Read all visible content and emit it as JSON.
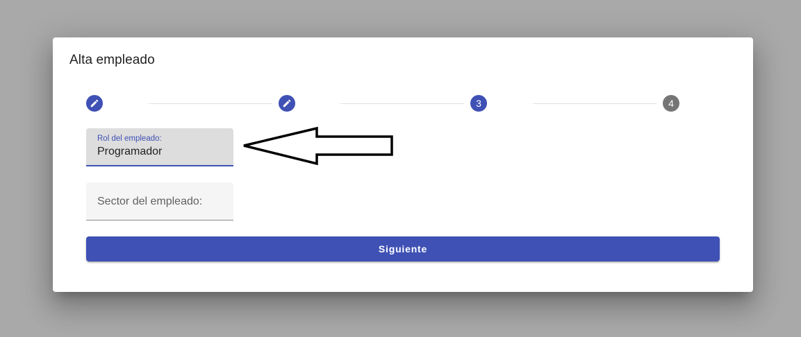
{
  "dialog": {
    "title": "Alta empleado"
  },
  "stepper": {
    "steps": [
      {
        "label": "",
        "state": "done",
        "icon": "pencil-icon"
      },
      {
        "label": "",
        "state": "done",
        "icon": "pencil-icon"
      },
      {
        "label": "3",
        "state": "active"
      },
      {
        "label": "4",
        "state": "pending"
      }
    ]
  },
  "form": {
    "role_field": {
      "label": "Rol del empleado:",
      "value": "Programador"
    },
    "sector_field": {
      "placeholder": "Sector del empleado:",
      "value": ""
    }
  },
  "actions": {
    "next_label": "Siguiente"
  },
  "colors": {
    "primary": "#3f51b5",
    "pending_step": "#757575",
    "backdrop": "#a9a9a9"
  }
}
